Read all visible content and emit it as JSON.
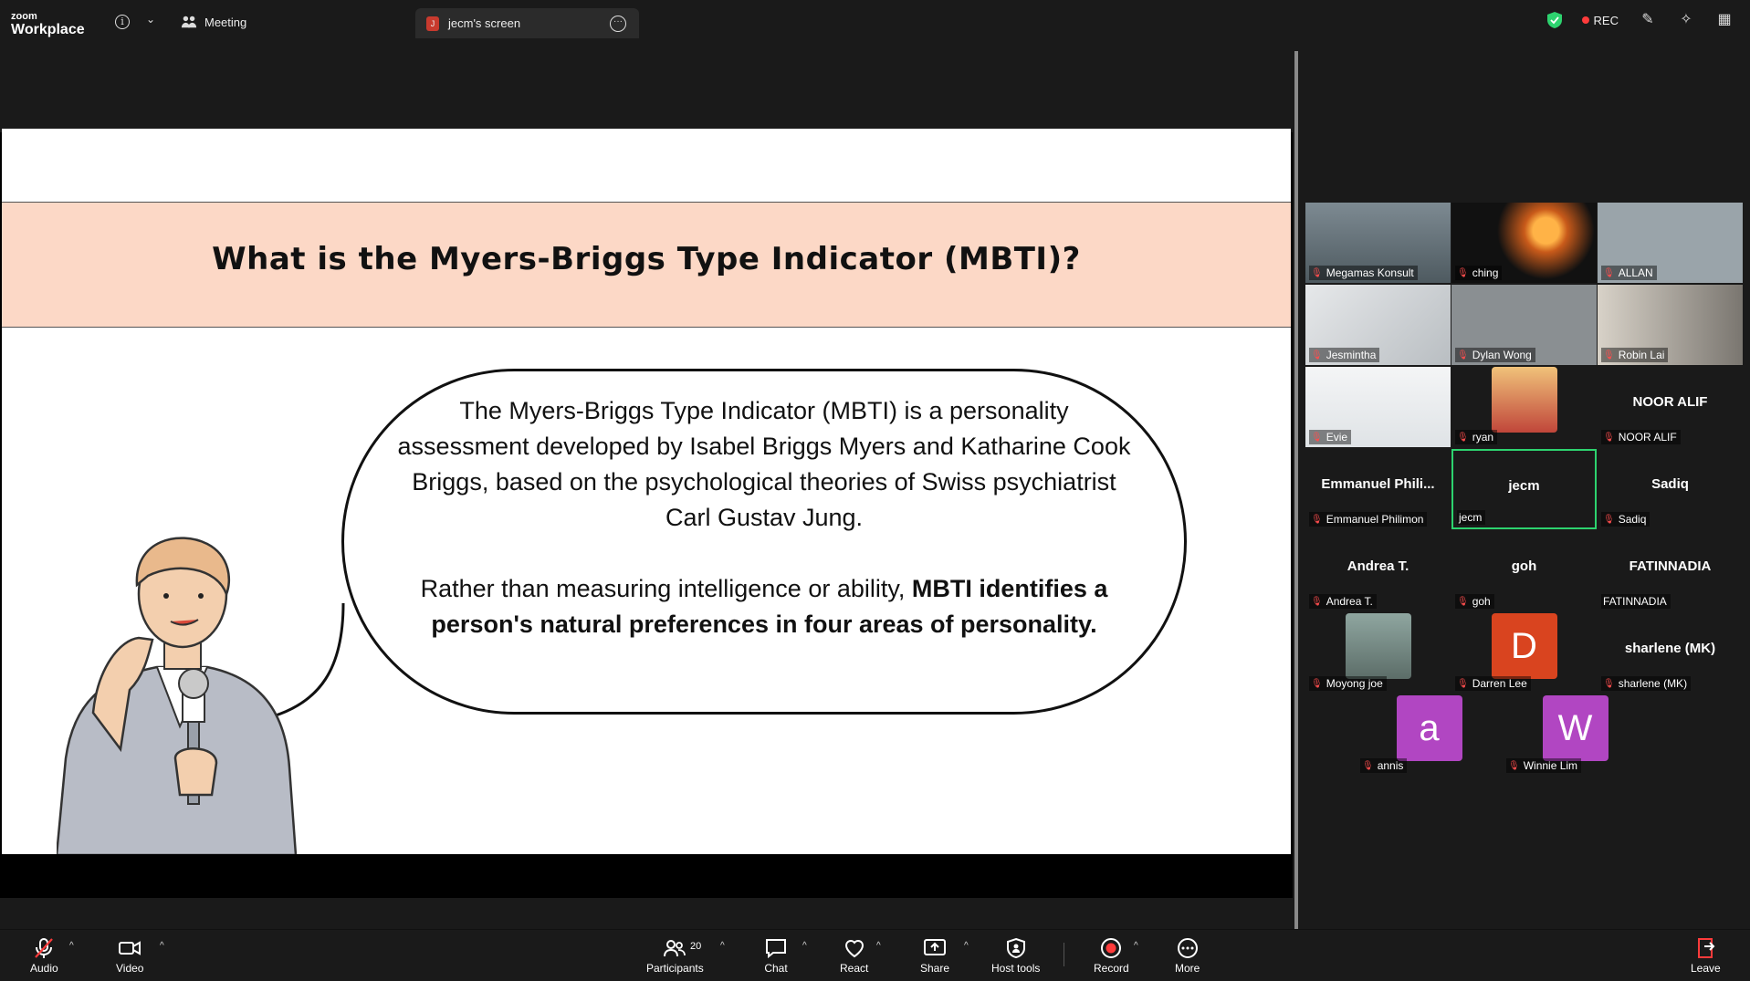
{
  "app": {
    "brand_small": "zoom",
    "brand_big": "Workplace"
  },
  "topbar": {
    "meeting_label": "Meeting",
    "screen_tab_label": "jecm's screen",
    "screen_tab_avatar": "J",
    "rec_label": "REC"
  },
  "slide": {
    "title": "What is the Myers-Briggs Type Indicator (MBTI)?",
    "para1": "The Myers-Briggs Type Indicator (MBTI) is a personality assessment developed by Isabel Briggs Myers and Katharine Cook Briggs, based on the psychological theories of Swiss psychiatrist Carl Gustav Jung.",
    "para2_normal": "Rather than measuring intelligence or ability, ",
    "para2_bold": "MBTI identifies a person's natural preferences in four areas of personality."
  },
  "participants": [
    {
      "name": "Megamas Konsult",
      "kind": "video"
    },
    {
      "name": "ching",
      "kind": "video"
    },
    {
      "name": "ALLAN",
      "kind": "video"
    },
    {
      "name": "Jesmintha",
      "kind": "video"
    },
    {
      "name": "Dylan Wong",
      "kind": "video"
    },
    {
      "name": "Robin Lai",
      "kind": "video"
    },
    {
      "name": "Evie",
      "kind": "video"
    },
    {
      "name": "ryan",
      "kind": "avatar-img"
    },
    {
      "name": "NOOR ALIF",
      "big": "NOOR ALIF",
      "kind": "name"
    },
    {
      "name": "Emmanuel Philimon",
      "big": "Emmanuel  Phili...",
      "kind": "name"
    },
    {
      "name": "jecm",
      "big": "jecm",
      "kind": "name",
      "active": true
    },
    {
      "name": "Sadiq",
      "big": "Sadiq",
      "kind": "name"
    },
    {
      "name": "Andrea T.",
      "big": "Andrea T.",
      "kind": "name"
    },
    {
      "name": "goh",
      "big": "goh",
      "kind": "name"
    },
    {
      "name": "FATINNADIA",
      "big": "FATINNADIA",
      "kind": "name"
    },
    {
      "name": "Moyong joe",
      "kind": "avatar-img"
    },
    {
      "name": "Darren Lee",
      "letter": "D",
      "kind": "letter",
      "color": "#d9441f"
    },
    {
      "name": "sharlene (MK)",
      "big": "sharlene (MK)",
      "kind": "name"
    },
    {
      "name": "annis",
      "letter": "a",
      "kind": "letter",
      "color": "#b146c2"
    },
    {
      "name": "Winnie Lim",
      "letter": "W",
      "kind": "letter",
      "color": "#b146c2"
    }
  ],
  "toolbar": {
    "audio": "Audio",
    "video": "Video",
    "participants": "Participants",
    "participants_count": "20",
    "chat": "Chat",
    "react": "React",
    "share": "Share",
    "host_tools": "Host tools",
    "record": "Record",
    "more": "More",
    "leave": "Leave"
  },
  "colors": {
    "accent_green": "#2dd36f",
    "rec_red": "#ff3b3b",
    "title_band": "#fcd8c6"
  }
}
